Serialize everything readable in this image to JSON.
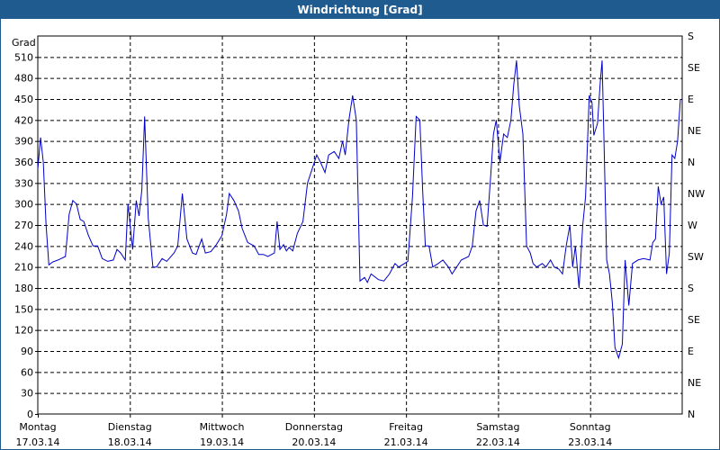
{
  "chart_data": {
    "type": "line",
    "title": "Windrichtung [Grad]",
    "ylabel": "Grad",
    "ylim": [
      0,
      540
    ],
    "yticks": [
      0,
      30,
      60,
      90,
      120,
      150,
      180,
      210,
      240,
      270,
      300,
      330,
      360,
      390,
      420,
      450,
      480,
      510
    ],
    "yticks_right": [
      {
        "value": 0,
        "label": "N"
      },
      {
        "value": 45,
        "label": "NE"
      },
      {
        "value": 90,
        "label": "E"
      },
      {
        "value": 135,
        "label": "SE"
      },
      {
        "value": 180,
        "label": "S"
      },
      {
        "value": 225,
        "label": "SW"
      },
      {
        "value": 270,
        "label": "W"
      },
      {
        "value": 315,
        "label": "NW"
      },
      {
        "value": 360,
        "label": "N"
      },
      {
        "value": 405,
        "label": "NE"
      },
      {
        "value": 450,
        "label": "E"
      },
      {
        "value": 495,
        "label": "SE"
      },
      {
        "value": 540,
        "label": "S"
      }
    ],
    "xlim": [
      0,
      7
    ],
    "xticks": [
      {
        "day": "Montag",
        "date": "17.03.14"
      },
      {
        "day": "Dienstag",
        "date": "18.03.14"
      },
      {
        "day": "Mittwoch",
        "date": "19.03.14"
      },
      {
        "day": "Donnerstag",
        "date": "20.03.14"
      },
      {
        "day": "Freitag",
        "date": "21.03.14"
      },
      {
        "day": "Samstag",
        "date": "22.03.14"
      },
      {
        "day": "Sonntag",
        "date": "23.03.14"
      }
    ],
    "grid": true,
    "series": [
      {
        "color": "#0000c8",
        "points": [
          [
            0.0,
            350
          ],
          [
            0.03,
            395
          ],
          [
            0.06,
            360
          ],
          [
            0.09,
            270
          ],
          [
            0.12,
            213
          ],
          [
            0.16,
            217
          ],
          [
            0.22,
            220
          ],
          [
            0.3,
            225
          ],
          [
            0.34,
            285
          ],
          [
            0.38,
            305
          ],
          [
            0.42,
            300
          ],
          [
            0.46,
            278
          ],
          [
            0.5,
            275
          ],
          [
            0.55,
            255
          ],
          [
            0.6,
            240
          ],
          [
            0.65,
            240
          ],
          [
            0.7,
            222
          ],
          [
            0.76,
            218
          ],
          [
            0.82,
            220
          ],
          [
            0.86,
            235
          ],
          [
            0.9,
            230
          ],
          [
            0.95,
            220
          ],
          [
            0.98,
            300
          ],
          [
            1.03,
            235
          ],
          [
            1.07,
            305
          ],
          [
            1.1,
            283
          ],
          [
            1.13,
            320
          ],
          [
            1.16,
            425
          ],
          [
            1.2,
            280
          ],
          [
            1.25,
            210
          ],
          [
            1.29,
            210
          ],
          [
            1.35,
            222
          ],
          [
            1.4,
            218
          ],
          [
            1.48,
            230
          ],
          [
            1.52,
            240
          ],
          [
            1.57,
            315
          ],
          [
            1.62,
            250
          ],
          [
            1.68,
            230
          ],
          [
            1.72,
            228
          ],
          [
            1.78,
            250
          ],
          [
            1.82,
            230
          ],
          [
            1.88,
            232
          ],
          [
            1.94,
            242
          ],
          [
            2.0,
            255
          ],
          [
            2.05,
            285
          ],
          [
            2.08,
            315
          ],
          [
            2.13,
            305
          ],
          [
            2.18,
            290
          ],
          [
            2.22,
            265
          ],
          [
            2.28,
            245
          ],
          [
            2.35,
            240
          ],
          [
            2.4,
            228
          ],
          [
            2.45,
            228
          ],
          [
            2.5,
            225
          ],
          [
            2.57,
            230
          ],
          [
            2.6,
            275
          ],
          [
            2.63,
            235
          ],
          [
            2.67,
            242
          ],
          [
            2.7,
            233
          ],
          [
            2.73,
            238
          ],
          [
            2.77,
            233
          ],
          [
            2.82,
            258
          ],
          [
            2.88,
            275
          ],
          [
            2.93,
            330
          ],
          [
            2.98,
            350
          ],
          [
            3.03,
            370
          ],
          [
            3.07,
            360
          ],
          [
            3.12,
            345
          ],
          [
            3.16,
            370
          ],
          [
            3.22,
            375
          ],
          [
            3.27,
            365
          ],
          [
            3.31,
            390
          ],
          [
            3.34,
            370
          ],
          [
            3.38,
            420
          ],
          [
            3.42,
            455
          ],
          [
            3.46,
            420
          ],
          [
            3.5,
            190
          ],
          [
            3.55,
            195
          ],
          [
            3.58,
            188
          ],
          [
            3.62,
            200
          ],
          [
            3.7,
            192
          ],
          [
            3.76,
            190
          ],
          [
            3.82,
            200
          ],
          [
            3.88,
            215
          ],
          [
            3.92,
            210
          ],
          [
            4.02,
            218
          ],
          [
            4.07,
            310
          ],
          [
            4.11,
            425
          ],
          [
            4.15,
            420
          ],
          [
            4.18,
            320
          ],
          [
            4.21,
            240
          ],
          [
            4.25,
            240
          ],
          [
            4.29,
            210
          ],
          [
            4.35,
            215
          ],
          [
            4.4,
            220
          ],
          [
            4.46,
            210
          ],
          [
            4.5,
            200
          ],
          [
            4.55,
            210
          ],
          [
            4.6,
            220
          ],
          [
            4.68,
            225
          ],
          [
            4.72,
            240
          ],
          [
            4.76,
            290
          ],
          [
            4.8,
            305
          ],
          [
            4.84,
            270
          ],
          [
            4.88,
            268
          ],
          [
            4.92,
            340
          ],
          [
            4.95,
            400
          ],
          [
            4.98,
            420
          ],
          [
            5.02,
            360
          ],
          [
            5.06,
            400
          ],
          [
            5.1,
            395
          ],
          [
            5.14,
            420
          ],
          [
            5.17,
            470
          ],
          [
            5.2,
            505
          ],
          [
            5.23,
            440
          ],
          [
            5.27,
            400
          ],
          [
            5.31,
            240
          ],
          [
            5.35,
            230
          ],
          [
            5.38,
            215
          ],
          [
            5.42,
            210
          ],
          [
            5.48,
            215
          ],
          [
            5.52,
            210
          ],
          [
            5.57,
            220
          ],
          [
            5.61,
            210
          ],
          [
            5.66,
            207
          ],
          [
            5.7,
            200
          ],
          [
            5.74,
            240
          ],
          [
            5.78,
            270
          ],
          [
            5.81,
            210
          ],
          [
            5.84,
            240
          ],
          [
            5.88,
            180
          ],
          [
            5.92,
            270
          ],
          [
            5.95,
            310
          ],
          [
            5.99,
            455
          ],
          [
            6.02,
            445
          ],
          [
            6.04,
            398
          ],
          [
            6.08,
            415
          ],
          [
            6.11,
            475
          ],
          [
            6.13,
            505
          ],
          [
            6.15,
            390
          ],
          [
            6.18,
            220
          ],
          [
            6.21,
            200
          ],
          [
            6.24,
            160
          ],
          [
            6.27,
            95
          ],
          [
            6.31,
            80
          ],
          [
            6.35,
            100
          ],
          [
            6.38,
            220
          ],
          [
            6.42,
            155
          ],
          [
            6.46,
            215
          ],
          [
            6.52,
            220
          ],
          [
            6.58,
            222
          ],
          [
            6.65,
            220
          ],
          [
            6.68,
            245
          ],
          [
            6.71,
            250
          ],
          [
            6.74,
            325
          ],
          [
            6.77,
            300
          ],
          [
            6.8,
            310
          ],
          [
            6.83,
            200
          ],
          [
            6.86,
            230
          ],
          [
            6.89,
            370
          ],
          [
            6.92,
            365
          ],
          [
            6.95,
            390
          ],
          [
            6.98,
            450
          ]
        ]
      }
    ]
  }
}
